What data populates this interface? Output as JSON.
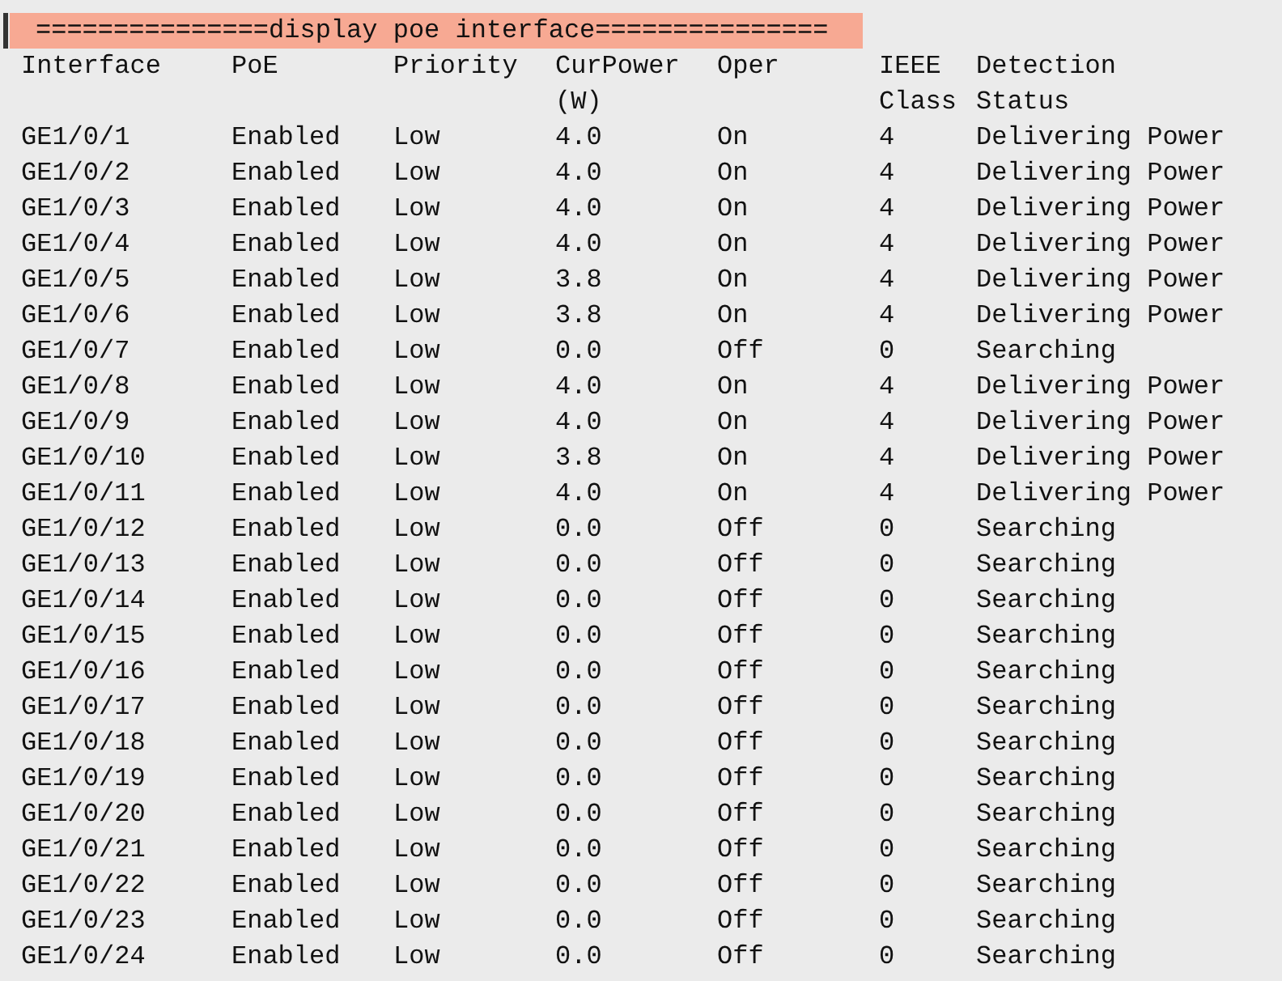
{
  "banner": "===============display poe interface===============",
  "columns": [
    "Interface",
    "PoE",
    "Priority",
    "CurPower (W)",
    "Oper",
    "IEEE Class",
    "Detection Status"
  ],
  "rows": [
    [
      "GE1/0/1",
      "Enabled",
      "Low",
      "4.0",
      "On",
      "4",
      "Delivering Power"
    ],
    [
      "GE1/0/2",
      "Enabled",
      "Low",
      "4.0",
      "On",
      "4",
      "Delivering Power"
    ],
    [
      "GE1/0/3",
      "Enabled",
      "Low",
      "4.0",
      "On",
      "4",
      "Delivering Power"
    ],
    [
      "GE1/0/4",
      "Enabled",
      "Low",
      "4.0",
      "On",
      "4",
      "Delivering Power"
    ],
    [
      "GE1/0/5",
      "Enabled",
      "Low",
      "3.8",
      "On",
      "4",
      "Delivering Power"
    ],
    [
      "GE1/0/6",
      "Enabled",
      "Low",
      "3.8",
      "On",
      "4",
      "Delivering Power"
    ],
    [
      "GE1/0/7",
      "Enabled",
      "Low",
      "0.0",
      "Off",
      "0",
      "Searching"
    ],
    [
      "GE1/0/8",
      "Enabled",
      "Low",
      "4.0",
      "On",
      "4",
      "Delivering Power"
    ],
    [
      "GE1/0/9",
      "Enabled",
      "Low",
      "4.0",
      "On",
      "4",
      "Delivering Power"
    ],
    [
      "GE1/0/10",
      "Enabled",
      "Low",
      "3.8",
      "On",
      "4",
      "Delivering Power"
    ],
    [
      "GE1/0/11",
      "Enabled",
      "Low",
      "4.0",
      "On",
      "4",
      "Delivering Power"
    ],
    [
      "GE1/0/12",
      "Enabled",
      "Low",
      "0.0",
      "Off",
      "0",
      "Searching"
    ],
    [
      "GE1/0/13",
      "Enabled",
      "Low",
      "0.0",
      "Off",
      "0",
      "Searching"
    ],
    [
      "GE1/0/14",
      "Enabled",
      "Low",
      "0.0",
      "Off",
      "0",
      "Searching"
    ],
    [
      "GE1/0/15",
      "Enabled",
      "Low",
      "0.0",
      "Off",
      "0",
      "Searching"
    ],
    [
      "GE1/0/16",
      "Enabled",
      "Low",
      "0.0",
      "Off",
      "0",
      "Searching"
    ],
    [
      "GE1/0/17",
      "Enabled",
      "Low",
      "0.0",
      "Off",
      "0",
      "Searching"
    ],
    [
      "GE1/0/18",
      "Enabled",
      "Low",
      "0.0",
      "Off",
      "0",
      "Searching"
    ],
    [
      "GE1/0/19",
      "Enabled",
      "Low",
      "0.0",
      "Off",
      "0",
      "Searching"
    ],
    [
      "GE1/0/20",
      "Enabled",
      "Low",
      "0.0",
      "Off",
      "0",
      "Searching"
    ],
    [
      "GE1/0/21",
      "Enabled",
      "Low",
      "0.0",
      "Off",
      "0",
      "Searching"
    ],
    [
      "GE1/0/22",
      "Enabled",
      "Low",
      "0.0",
      "Off",
      "0",
      "Searching"
    ],
    [
      "GE1/0/23",
      "Enabled",
      "Low",
      "0.0",
      "Off",
      "0",
      "Searching"
    ],
    [
      "GE1/0/24",
      "Enabled",
      "Low",
      "0.0",
      "Off",
      "0",
      "Searching"
    ]
  ]
}
